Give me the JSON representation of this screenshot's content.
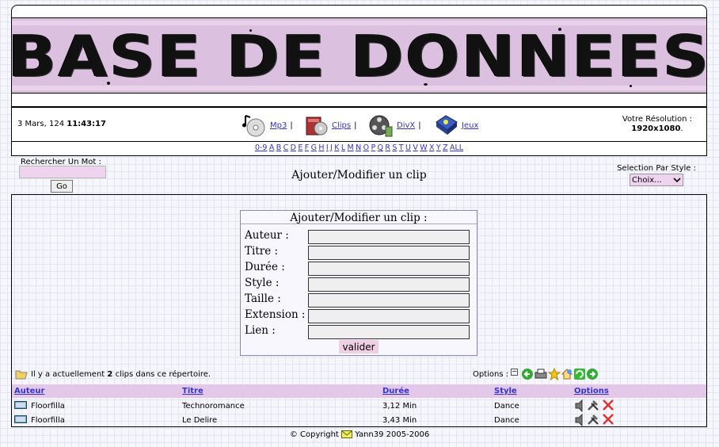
{
  "banner": {
    "title": "BASE DE DONNEES"
  },
  "datetime": {
    "date": "3 Mars, 124",
    "time": "11:43:17"
  },
  "nav": {
    "items": [
      {
        "label": "Mp3",
        "icon": "cd-music-icon"
      },
      {
        "label": "Clips",
        "icon": "clips-book-icon"
      },
      {
        "label": "DivX",
        "icon": "film-reel-icon"
      },
      {
        "label": "Jeux",
        "icon": "game-disk-icon"
      }
    ],
    "separator": "|"
  },
  "resolution": {
    "label": "Votre Résolution :",
    "value": "1920x1080",
    "suffix": "."
  },
  "letters": [
    "0-9",
    "A",
    "B",
    "C",
    "D",
    "E",
    "F",
    "G",
    "H",
    "I",
    "J",
    "K",
    "L",
    "M",
    "N",
    "O",
    "P",
    "Q",
    "R",
    "S",
    "T",
    "U",
    "V",
    "W",
    "X",
    "Y",
    "Z",
    "ALL"
  ],
  "search": {
    "label": "Rechercher Un Mot :",
    "value": "",
    "button": "Go"
  },
  "page_heading": "Ajouter/Modifier un clip",
  "style_select": {
    "label": "Selection Par Style :",
    "selected": "Choix..."
  },
  "form": {
    "title": "Ajouter/Modifier un clip :",
    "fields": [
      {
        "label": "Auteur :",
        "value": ""
      },
      {
        "label": "Titre :",
        "value": ""
      },
      {
        "label": "Durée :",
        "value": ""
      },
      {
        "label": "Style :",
        "value": ""
      },
      {
        "label": "Taille :",
        "value": ""
      },
      {
        "label": "Extension :",
        "value": ""
      },
      {
        "label": "Lien :",
        "value": ""
      }
    ],
    "submit": "valider"
  },
  "status": {
    "prefix": "Il y a actuellement",
    "count": "2",
    "suffix": "clips dans ce répertoire."
  },
  "options": {
    "label": "Options :",
    "collapse": "−"
  },
  "table": {
    "headers": [
      "Auteur",
      "Titre",
      "Durée",
      "Style",
      "Options"
    ],
    "rows": [
      {
        "auteur": "Floorfilla",
        "titre": "Technoromance",
        "duree": "3,12 Min",
        "style": "Dance"
      },
      {
        "auteur": "Floorfilla",
        "titre": "Le Delire",
        "duree": "3,43 Min",
        "style": "Dance"
      }
    ]
  },
  "footer": {
    "copyright": "© Copyright",
    "author": "Yann39 2005-2006"
  },
  "colors": {
    "accent_pink": "#dcc0df",
    "link": "#3333cc",
    "header_row": "#e4c8ea",
    "input_pink": "#efd4f0"
  }
}
